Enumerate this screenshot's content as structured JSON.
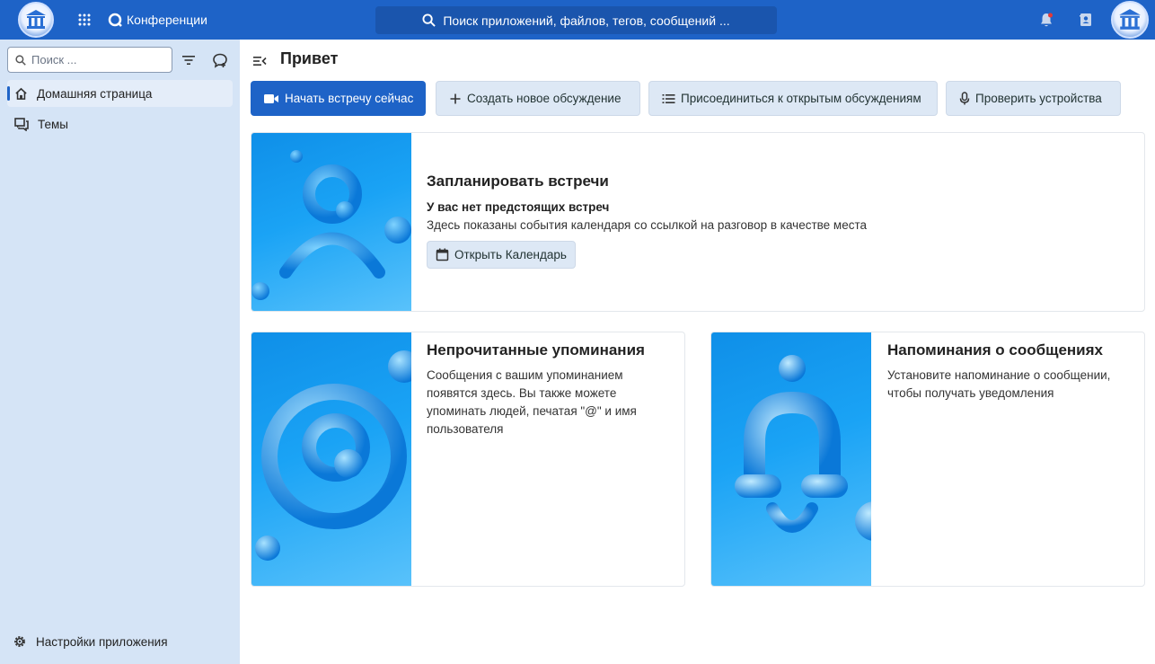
{
  "topbar": {
    "app_name": "Конференции",
    "search_placeholder": "Поиск приложений, файлов, тегов, сообщений ..."
  },
  "sidebar": {
    "search_placeholder": "Поиск ...",
    "items": [
      {
        "label": "Домашняя страница",
        "icon": "home-icon",
        "active": true
      },
      {
        "label": "Темы",
        "icon": "threads-icon",
        "active": false
      }
    ],
    "settings_label": "Настройки приложения"
  },
  "main": {
    "title": "Привет",
    "actions": {
      "start_meeting": "Начать встречу сейчас",
      "new_conversation": "Создать новое обсуждение",
      "join_open": "Присоединиться к открытым обсуждениям",
      "check_devices": "Проверить устройства"
    },
    "schedule_card": {
      "title": "Запланировать встречи",
      "subtitle": "У вас нет предстоящих встреч",
      "text": "Здесь показаны события календаря со ссылкой на разговор в качестве места",
      "button": "Открыть Календарь"
    },
    "mentions_card": {
      "title": "Непрочитанные упоминания",
      "text": "Сообщения с вашим упоминанием появятся здесь. Вы также можете упоминать людей, печатая \"@\" и имя пользователя"
    },
    "reminders_card": {
      "title": "Напоминания о сообщениях",
      "text": "Установите напоминание о сообщении, чтобы получать уведомления"
    }
  },
  "colors": {
    "accent": "#1e63c7",
    "sidebar_bg": "#d5e4f6",
    "secondary_button": "#dde8f5"
  }
}
